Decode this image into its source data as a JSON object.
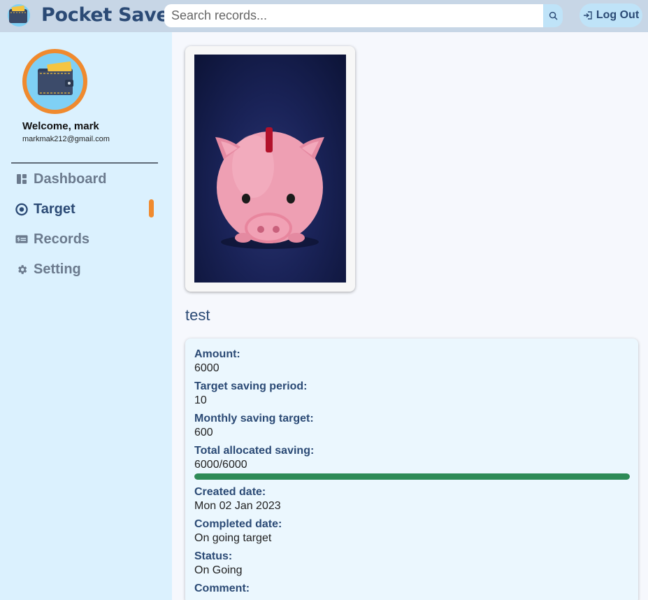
{
  "app": {
    "title": "Pocket Save"
  },
  "search": {
    "placeholder": "Search records..."
  },
  "header": {
    "logout_label": "Log Out"
  },
  "user": {
    "welcome": "Welcome, mark",
    "email": "markmak212@gmail.com"
  },
  "sidebar": {
    "items": [
      {
        "label": "Dashboard",
        "icon": "dashboard-icon",
        "active": false
      },
      {
        "label": "Target",
        "icon": "target-icon",
        "active": true
      },
      {
        "label": "Records",
        "icon": "records-icon",
        "active": false
      },
      {
        "label": "Setting",
        "icon": "gear-icon",
        "active": false
      }
    ]
  },
  "target": {
    "name": "test",
    "image": "piggy-bank-photo",
    "fields": {
      "amount_label": "Amount:",
      "amount": "6000",
      "period_label": "Target saving period:",
      "period": "10",
      "monthly_label": "Monthly saving target:",
      "monthly": "600",
      "allocated_label": "Total allocated saving:",
      "allocated": "6000/6000",
      "progress_fraction": 1.0,
      "created_label": "Created date:",
      "created": "Mon 02 Jan 2023",
      "completed_label": "Completed date:",
      "completed": "On going target",
      "status_label": "Status:",
      "status": "On Going",
      "comment_label": "Comment:"
    }
  },
  "colors": {
    "brand": "#2b4a75",
    "accent": "#f08a2e",
    "progress": "#2e8b57",
    "sidebar_bg": "#dbf1fe",
    "topbar_bg": "#c7d6e6"
  }
}
